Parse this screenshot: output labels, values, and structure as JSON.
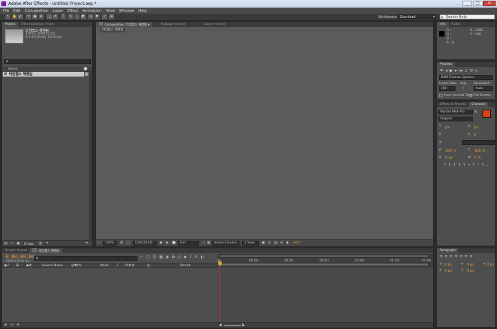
{
  "window": {
    "title": "Adobe After Effects - Untitled Project.aep *",
    "minimize": "_",
    "maximize": "□",
    "close": "✕"
  },
  "menu": [
    "File",
    "Edit",
    "Composition",
    "Layer",
    "Effect",
    "Animation",
    "View",
    "Window",
    "Help"
  ],
  "toolbar": {
    "workspace_label": "Workspace:",
    "workspace_value": "Standard",
    "search_placeholder": "Search Help"
  },
  "project": {
    "tabs": [
      "Project",
      "Effect Controls: Front"
    ],
    "comp_name": "타임랩스 해켕팀",
    "comp_line1": "1920 x 1080 (1.00)",
    "comp_line2": "Δ 0;03;30;00, 30.00 fps",
    "search_glyph": "ρ",
    "column_name": "Name",
    "item_name": "타임랩스 해켕팀",
    "bpc": "8 bpc"
  },
  "composition": {
    "tabs": [
      "Composition: 타임랩스 해켕팀",
      "Footage: (none)",
      "Layer: (none)"
    ],
    "subtab": "타임랩스 해켕팀",
    "zoom": "100%",
    "timecode": "0;00;00;00",
    "resolution": "Full",
    "camera": "Active Camera",
    "views": "1 View",
    "exposure": "+0.0"
  },
  "info": {
    "tabs": [
      "Info",
      "Audio"
    ],
    "r": "R :",
    "g": "G :",
    "b": "B :",
    "a": "A : 0",
    "x": "X : 1282",
    "y": "Y : 198"
  },
  "preview": {
    "tab": "Preview",
    "ram_label": "RAM Preview Options",
    "frame_rate_label": "Frame Rate",
    "skip_label": "Skip",
    "resolution_label": "Resolution",
    "frame_rate": "(30)",
    "skip": "0",
    "resolution": "Auto",
    "from_current": "From Current Time",
    "full_screen": "Full Screen"
  },
  "character": {
    "tabs": [
      "Effects & Presets",
      "Characte"
    ],
    "font": "Myriad Web Pro",
    "style": "Regular",
    "size": "px",
    "leading": "px",
    "tracking": "0",
    "scale_v": "100 %",
    "scale_h": "100 %",
    "baseline": "0 px",
    "tsume": "0 %"
  },
  "paragraph": {
    "tab": "Paragraph",
    "indent1": "0 px",
    "indent2": "0 px",
    "indent3": "0 px",
    "space1": "0 px",
    "space2": "0 px"
  },
  "timeline": {
    "tabs": [
      "Render Queue",
      "타임랩스 해켕팀"
    ],
    "timecode": "0;00;00;00",
    "fps_text": "00000 (30.00 fps)",
    "search_glyph": "ρ",
    "col_source": "Source Name",
    "col_mode": "Mode",
    "col_t": "T",
    "col_trkmat": "TrkMat",
    "col_parent": "Parent",
    "ruler": [
      "0s",
      "00:15s",
      "00:30s",
      "00:45s",
      "01:00s",
      "01:15s",
      "01:30s"
    ],
    "ruler_end": "01:30s"
  },
  "colors": {
    "accent_orange": "#e0a040",
    "playhead": "#d13030",
    "fill_swatch": "#e04010"
  }
}
